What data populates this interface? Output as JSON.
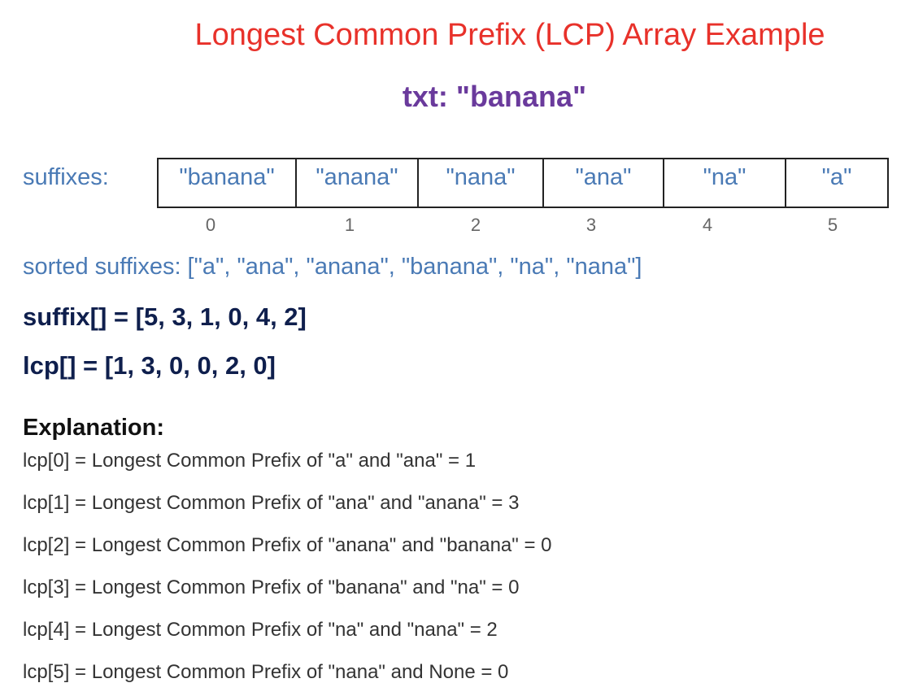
{
  "title": "Longest Common Prefix (LCP) Array Example",
  "subtitle": "txt: \"banana\"",
  "suffixes": {
    "label": "suffixes:",
    "cells": [
      "\"banana\"",
      "\"anana\"",
      "\"nana\"",
      "\"ana\"",
      "\"na\"",
      "\"a\""
    ],
    "indices": [
      "0",
      "1",
      "2",
      "3",
      "4",
      "5"
    ]
  },
  "sorted": "sorted suffixes:  [\"a\", \"ana\", \"anana\", \"banana\", \"na\", \"nana\"]",
  "suffix_array": "suffix[]  = [5, 3, 1, 0, 4, 2]",
  "lcp_array": "lcp[]     =  [1, 3, 0, 0, 2, 0]",
  "explanation": {
    "heading": "Explanation:",
    "lines": [
      "lcp[0] = Longest Common Prefix of \"a\" and \"ana\" = 1",
      "lcp[1] = Longest Common Prefix of \"ana\" and \"anana\" = 3",
      "lcp[2] = Longest Common Prefix of \"anana\" and \"banana\" = 0",
      "lcp[3] = Longest Common Prefix of \"banana\" and \"na\" = 0",
      "lcp[4] = Longest Common Prefix of \"na\" and \"nana\" = 2",
      "lcp[5] = Longest Common Prefix of \"nana\" and None = 0"
    ]
  },
  "colors": {
    "title": "#e8312a",
    "subtitle": "#6a3a9c",
    "blue_text": "#4a7ab5",
    "array_text": "#0f1f4d"
  }
}
